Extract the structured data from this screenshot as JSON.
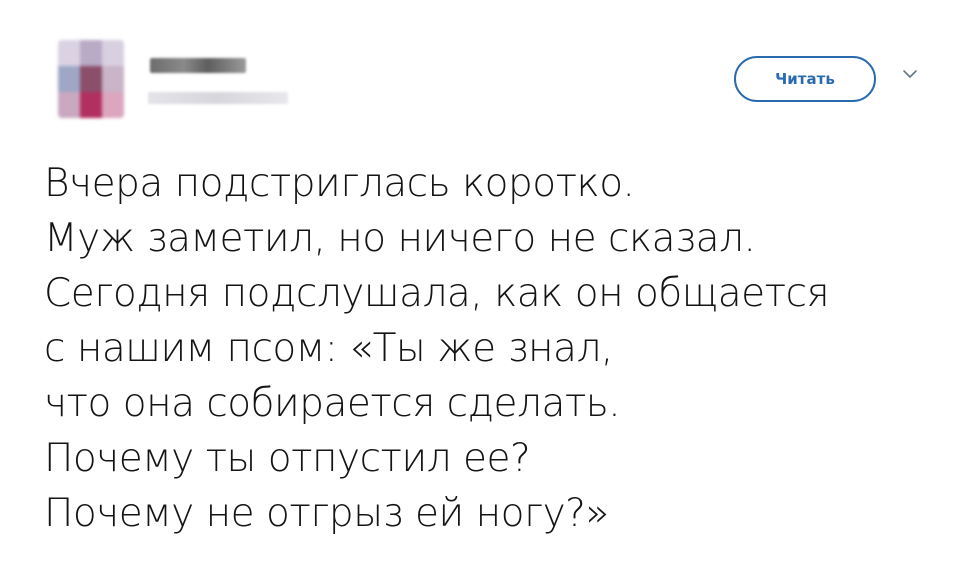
{
  "tweet": {
    "follow_label": "Читать",
    "lines": [
      "Вчера подстриглась коротко.",
      "Муж заметил, но ничего не сказал.",
      "Сегодня подслушала, как он общается",
      "с нашим псом: «Ты же знал,",
      "что она собирается сделать.",
      "Почему ты отпустил ее?",
      "Почему не отгрыз ей ногу?»"
    ]
  },
  "icons": {
    "menu": "chevron-down-icon"
  },
  "colors": {
    "accent": "#2a6bb0",
    "text": "#141414",
    "background": "#ffffff"
  }
}
